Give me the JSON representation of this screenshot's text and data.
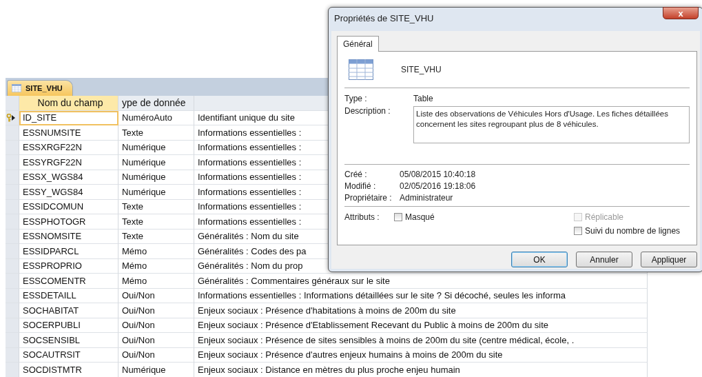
{
  "table_window": {
    "tab": {
      "label": "SITE_VHU",
      "selected": true
    },
    "columns": [
      {
        "label": "Nom du champ",
        "selected": true
      },
      {
        "label": "ype de donnée",
        "selected": false
      }
    ],
    "rows": [
      {
        "name": "ID_SITE",
        "type": "NuméroAuto",
        "description": "Identifiant unique du site",
        "selected": true,
        "primary_key": true
      },
      {
        "name": "ESSNUMSITE",
        "type": "Texte",
        "description": "Informations essentielles :",
        "selected": false,
        "primary_key": false
      },
      {
        "name": "ESSXRGF22N",
        "type": "Numérique",
        "description": "Informations essentielles :",
        "selected": false,
        "primary_key": false
      },
      {
        "name": "ESSYRGF22N",
        "type": "Numérique",
        "description": "Informations essentielles :",
        "selected": false,
        "primary_key": false
      },
      {
        "name": "ESSX_WGS84",
        "type": "Numérique",
        "description": "Informations essentielles :",
        "selected": false,
        "primary_key": false
      },
      {
        "name": "ESSY_WGS84",
        "type": "Numérique",
        "description": "Informations essentielles :",
        "selected": false,
        "primary_key": false
      },
      {
        "name": "ESSIDCOMUN",
        "type": "Texte",
        "description": "Informations essentielles :",
        "selected": false,
        "primary_key": false
      },
      {
        "name": "ESSPHOTOGR",
        "type": "Texte",
        "description": "Informations essentielles :",
        "selected": false,
        "primary_key": false
      },
      {
        "name": "ESSNOMSITE",
        "type": "Texte",
        "description": "Généralités : Nom du site",
        "selected": false,
        "primary_key": false
      },
      {
        "name": "ESSIDPARCL",
        "type": "Mémo",
        "description": "Généralités : Codes des pa",
        "selected": false,
        "primary_key": false
      },
      {
        "name": "ESSPROPRIO",
        "type": "Mémo",
        "description": "Généralités : Nom du prop",
        "selected": false,
        "primary_key": false
      },
      {
        "name": "ESSCOMENTR",
        "type": "Mémo",
        "description": "Généralités : Commentaires généraux sur le site",
        "selected": false,
        "primary_key": false
      },
      {
        "name": "ESSDETAILL",
        "type": "Oui/Non",
        "description": "Informations essentielles : Informations détaillées sur le site ? Si décoché, seules les informa",
        "selected": false,
        "primary_key": false
      },
      {
        "name": "SOCHABITAT",
        "type": "Oui/Non",
        "description": "Enjeux sociaux : Présence d'habitations à moins de 200m du site",
        "selected": false,
        "primary_key": false
      },
      {
        "name": "SOCERPUBLI",
        "type": "Oui/Non",
        "description": "Enjeux sociaux : Présence d'Etablissement Recevant du Public à moins de 200m du site",
        "selected": false,
        "primary_key": false
      },
      {
        "name": "SOCSENSIBL",
        "type": "Oui/Non",
        "description": "Enjeux sociaux : Présence de sites sensibles à moins de 200m du site (centre médical, école, .",
        "selected": false,
        "primary_key": false
      },
      {
        "name": "SOCAUTRSIT",
        "type": "Oui/Non",
        "description": "Enjeux sociaux : Présence d'autres enjeux humains à moins de 200m du site",
        "selected": false,
        "primary_key": false
      },
      {
        "name": "SOCDISTMTR",
        "type": "Numérique",
        "description": "Enjeux sociaux : Distance en mètres du plus proche enjeu humain",
        "selected": false,
        "primary_key": false
      }
    ]
  },
  "dialog": {
    "title": "Propriétés de SITE_VHU",
    "close": "x",
    "tabs": [
      {
        "label": "Général",
        "selected": true
      }
    ],
    "object_name": "SITE_VHU",
    "type_label": "Type :",
    "type_value": "Table",
    "description_label": "Description :",
    "description": "Liste des observations de Véhicules Hors d'Usage. Les fiches détaillées concernent les sites regroupant plus de 8 véhicules.",
    "dates": [
      {
        "label": "Créé :",
        "value": "05/08/2015 10:40:18"
      },
      {
        "label": "Modifié :",
        "value": "02/05/2016 19:18:06"
      },
      {
        "label": "Propriétaire :",
        "value": "Administrateur"
      }
    ],
    "attributes_label": "Attributs :",
    "attributes": [
      {
        "label": "Masqué",
        "checked": false,
        "disabled": false
      },
      {
        "label": "Réplicable",
        "checked": false,
        "disabled": true
      },
      {
        "label": "Suivi du nombre de lignes",
        "checked": false,
        "disabled": false
      }
    ],
    "buttons": [
      {
        "label": "OK",
        "default": true
      },
      {
        "label": "Annuler",
        "default": false
      },
      {
        "label": "Appliquer",
        "default": false
      }
    ]
  }
}
